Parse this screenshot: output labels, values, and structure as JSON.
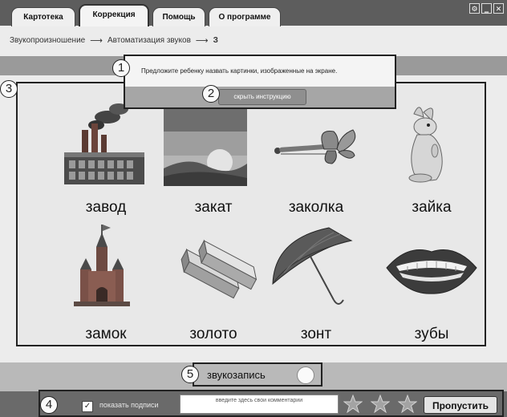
{
  "tabs": [
    {
      "label": "Картотека"
    },
    {
      "label": "Коррекция"
    },
    {
      "label": "Помощь"
    },
    {
      "label": "О программе"
    }
  ],
  "window_controls": {
    "settings": "⚙",
    "minimize": "‗",
    "close": "✕"
  },
  "breadcrumb": {
    "item1": "Звукопроизношение",
    "sep": "⟶",
    "item2": "Автоматизация звуков",
    "item3": "З"
  },
  "popup": {
    "message": "Предложите ребенку назвать картинки, изображенные на экране.",
    "hide_button": "скрыть инструкцию"
  },
  "cards": [
    {
      "word": "завод",
      "icon": "factory-icon"
    },
    {
      "word": "закат",
      "icon": "sunset-icon"
    },
    {
      "word": "заколка",
      "icon": "hairpin-icon"
    },
    {
      "word": "зайка",
      "icon": "bunny-icon"
    },
    {
      "word": "замок",
      "icon": "castle-icon"
    },
    {
      "word": "золото",
      "icon": "gold-bars-icon"
    },
    {
      "word": "зонт",
      "icon": "umbrella-icon"
    },
    {
      "word": "зубы",
      "icon": "teeth-icon"
    }
  ],
  "markers": [
    "1",
    "2",
    "3",
    "4",
    "5"
  ],
  "recording": {
    "label": "звукозапись"
  },
  "footer": {
    "show_captions": "показать подписи",
    "checkbox_mark": "✓",
    "comment_placeholder": "введите здесь свои комментарии",
    "rating": 0,
    "skip_button": "Пропустить"
  }
}
